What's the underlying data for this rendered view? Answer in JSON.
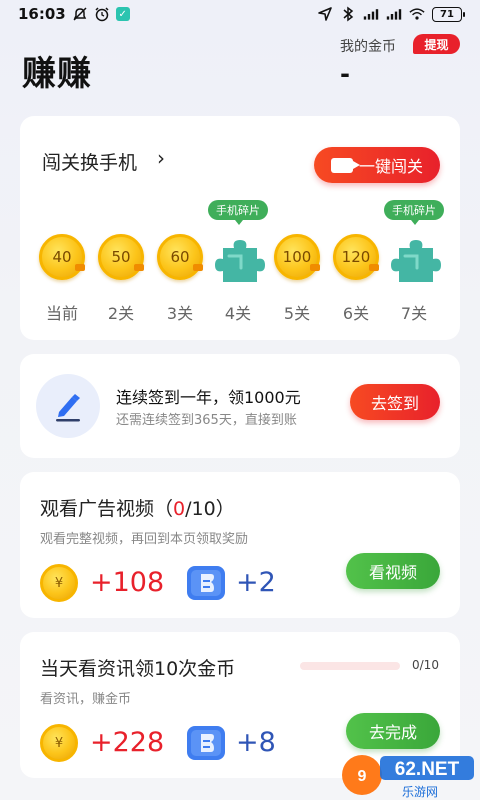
{
  "status_bar": {
    "time": "16:03",
    "battery": "71"
  },
  "header": {
    "title": "赚赚",
    "coins_label": "我的金币",
    "withdraw_label": "提现",
    "coins_value": "-"
  },
  "challenge": {
    "title": "闯关换手机",
    "button_label": "一键闯关",
    "piece_tag": "手机碎片",
    "levels": [
      {
        "coin": "40",
        "label": "当前"
      },
      {
        "coin": "50",
        "label": "2关"
      },
      {
        "coin": "60",
        "label": "3关"
      },
      {
        "coin": "",
        "label": "4关",
        "piece": true
      },
      {
        "coin": "100",
        "label": "5关"
      },
      {
        "coin": "120",
        "label": "6关"
      },
      {
        "coin": "",
        "label": "7关",
        "piece": true
      }
    ]
  },
  "signin": {
    "title": "连续签到一年，领1000元",
    "subtitle": "还需连续签到365天，直接到账",
    "button_label": "去签到"
  },
  "video": {
    "title_prefix": "观看广告视频（",
    "title_done": "0",
    "title_suffix": "/10）",
    "subtitle": "观看完整视频，再回到本页领取奖励",
    "coin_symbol": "¥",
    "coin_reward": "+108",
    "ticket_reward": "+2",
    "button_label": "看视频"
  },
  "news": {
    "title": "当天看资讯领10次金币",
    "subtitle": "看资讯，赚金币",
    "progress_text": "0/10",
    "progress_fraction": 0,
    "coin_symbol": "¥",
    "coin_reward": "+228",
    "ticket_reward": "+8",
    "button_label": "去完成"
  },
  "watermark": {
    "text": "962.NET",
    "subtext": "乐游网"
  },
  "colors": {
    "accent_red": "#e8212b",
    "accent_green": "#3fae5a",
    "ticket_blue": "#2f55b6"
  }
}
